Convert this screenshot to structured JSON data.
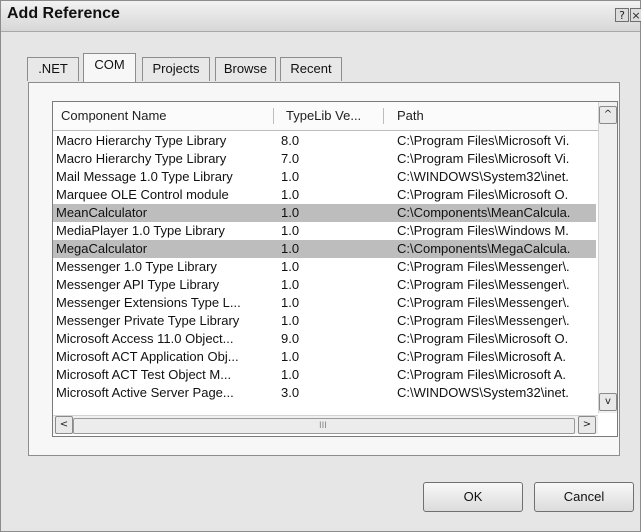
{
  "window": {
    "title": "Add Reference",
    "help_glyph": "?",
    "close_glyph": "×"
  },
  "tabs": [
    ".NET",
    "COM",
    "Projects",
    "Browse",
    "Recent"
  ],
  "active_tab": "COM",
  "columns": [
    "Component Name",
    "TypeLib Ve...",
    "Path"
  ],
  "rows": [
    {
      "name": "Macro Hierarchy Type Library",
      "version": "8.0",
      "path": "C:\\Program Files\\Microsoft Vi."
    },
    {
      "name": "Macro Hierarchy Type Library",
      "version": "7.0",
      "path": "C:\\Program Files\\Microsoft Vi."
    },
    {
      "name": "Mail Message 1.0 Type Library",
      "version": "1.0",
      "path": "C:\\WINDOWS\\System32\\inet."
    },
    {
      "name": "Marquee OLE Control module",
      "version": "1.0",
      "path": "C:\\Program Files\\Microsoft O."
    },
    {
      "name": "MeanCalculator",
      "version": "1.0",
      "path": "C:\\Components\\MeanCalcula.",
      "selected": true
    },
    {
      "name": "MediaPlayer 1.0 Type Library",
      "version": "1.0",
      "path": "C:\\Program Files\\Windows M."
    },
    {
      "name": "MegaCalculator",
      "version": "1.0",
      "path": "C:\\Components\\MegaCalcula.",
      "selected": true
    },
    {
      "name": "Messenger 1.0 Type Library",
      "version": "1.0",
      "path": "C:\\Program Files\\Messenger\\."
    },
    {
      "name": "Messenger API Type Library",
      "version": "1.0",
      "path": "C:\\Program Files\\Messenger\\."
    },
    {
      "name": "Messenger Extensions Type L...",
      "version": "1.0",
      "path": "C:\\Program Files\\Messenger\\."
    },
    {
      "name": "Messenger Private Type Library",
      "version": "1.0",
      "path": "C:\\Program Files\\Messenger\\."
    },
    {
      "name": "Microsoft Access 11.0 Object...",
      "version": "9.0",
      "path": "C:\\Program Files\\Microsoft O."
    },
    {
      "name": "Microsoft ACT Application Obj...",
      "version": "1.0",
      "path": "C:\\Program Files\\Microsoft A."
    },
    {
      "name": "Microsoft ACT Test Object M...",
      "version": "1.0",
      "path": "C:\\Program Files\\Microsoft A."
    },
    {
      "name": "Microsoft Active Server Page...",
      "version": "3.0",
      "path": "C:\\WINDOWS\\System32\\inet."
    }
  ],
  "scroll": {
    "up": "^",
    "down": "v",
    "left": "<",
    "right": ">",
    "grip": "III"
  },
  "buttons": {
    "ok": "OK",
    "cancel": "Cancel"
  }
}
